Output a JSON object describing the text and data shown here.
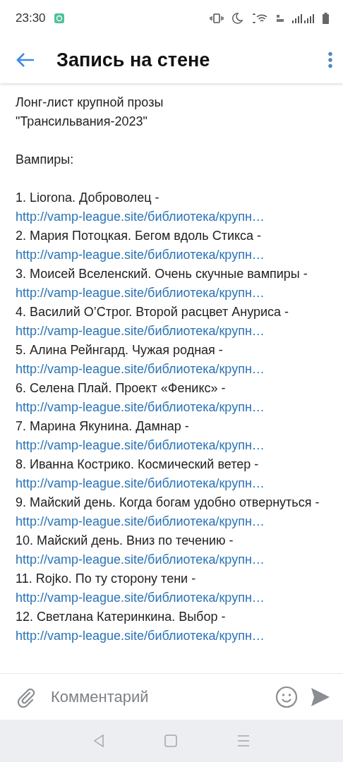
{
  "status_bar": {
    "time": "23:30"
  },
  "header": {
    "title": "Запись на стене"
  },
  "post": {
    "title_lines": [
      "Лонг-лист крупной прозы",
      "\"Трансильвания-2023\""
    ],
    "section": "Вампиры:",
    "entries": [
      {
        "text": "1. Liorona. Доброволец -",
        "link": "http://vamp-league.site/библиотека/крупн…"
      },
      {
        "text": "2. Мария Потоцкая. Бегом вдоль Стикса -",
        "link": "http://vamp-league.site/библиотека/крупн…"
      },
      {
        "text": "3. Моисей Вселенский. Очень скучные вампиры -",
        "link": "http://vamp-league.site/библиотека/крупн…"
      },
      {
        "text": "4. Василий О’Строг. Второй расцвет Ануриса -",
        "link": "http://vamp-league.site/библиотека/крупн…"
      },
      {
        "text": "5. Алина Рейнгард. Чужая родная -",
        "link": "http://vamp-league.site/библиотека/крупн…"
      },
      {
        "text": "6. Селена Плай. Проект «Феникс» -",
        "link": "http://vamp-league.site/библиотека/крупн…"
      },
      {
        "text": "7. Марина Якунина. Дамнар -",
        "link": "http://vamp-league.site/библиотека/крупн…"
      },
      {
        "text": "8. Иванна Кострико. Космический ветер -",
        "link": "http://vamp-league.site/библиотека/крупн…"
      },
      {
        "text": "9. Майский день. Когда богам удобно отвернуться -",
        "link": "http://vamp-league.site/библиотека/крупн…"
      },
      {
        "text": "10. Майский день. Вниз по течению -",
        "link": "http://vamp-league.site/библиотека/крупн…"
      },
      {
        "text": "11. Rojko. По ту сторону тени -",
        "link": "http://vamp-league.site/библиотека/крупн…"
      },
      {
        "text": "12. Светлана Катеринкина. Выбор -",
        "link": "http://vamp-league.site/библиотека/крупн…"
      }
    ]
  },
  "comment_bar": {
    "placeholder": "Комментарий"
  }
}
